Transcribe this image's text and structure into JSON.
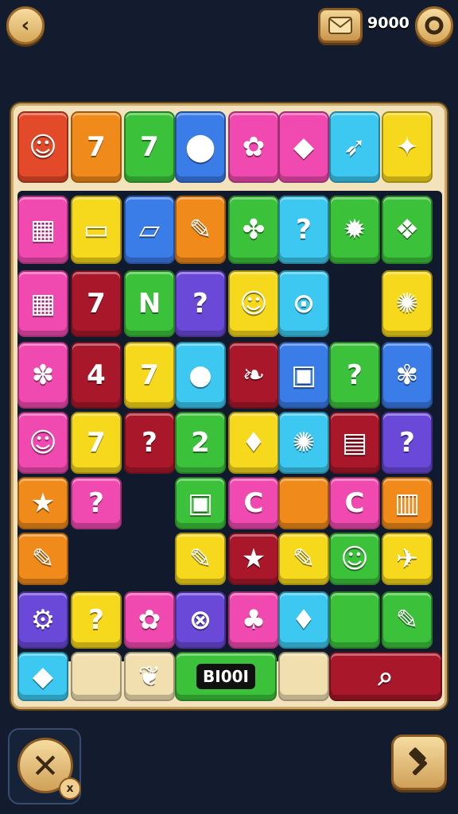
{
  "header": {
    "back_icon": "chevron-left-icon",
    "mail_icon": "envelope-icon",
    "coins": "9000",
    "settings_icon": "ring-icon"
  },
  "board": {
    "score_label": "BI00I",
    "top_row_glyphs": [
      "☺",
      "7",
      "7",
      "⬤",
      "✿",
      "◆",
      "➶",
      "✦"
    ],
    "row1_glyphs": [
      "▦",
      "▭",
      "▱",
      "✎",
      "✤",
      "?",
      "✹",
      "❖"
    ],
    "row2_glyphs": [
      "▦",
      "7",
      "N",
      "?",
      "☺",
      "⊙",
      "",
      "✺"
    ],
    "row3_glyphs": [
      "✽",
      "4",
      "7",
      "●",
      "❧",
      "▣",
      "?",
      "✾"
    ],
    "row4_glyphs": [
      "☺",
      "7",
      "?",
      "2",
      "♦",
      "✺",
      "▤",
      "?"
    ],
    "row5_glyphs": [
      "★",
      "?",
      "",
      "▣",
      "C",
      "",
      "C",
      "▥"
    ],
    "row6_glyphs": [
      "✎",
      "",
      "",
      "✎",
      "★",
      "✎",
      "☺",
      "✈"
    ],
    "row7_glyphs": [
      "⚙",
      "?",
      "✿",
      "⊗",
      "♣",
      "♦",
      "",
      "✎"
    ],
    "row8_glyphs": [
      "◆",
      "",
      "❦",
      "",
      "",
      "",
      "⌕",
      ""
    ]
  },
  "footer": {
    "shuffle_icon": "crossed-tools-icon",
    "shuffle_badge": "x",
    "hammer_icon": "hammer-icon"
  },
  "colors": {
    "background": "#121c2e",
    "board": "#f3e3bd",
    "red": "#e24a2a",
    "orange": "#f08a1a",
    "green": "#3cc23a",
    "blue": "#3a7ce8",
    "pink": "#f04ab0",
    "cyan": "#3cc8f0",
    "yellow": "#f6d81c",
    "purple": "#6a48d8",
    "darkred": "#a8182a"
  }
}
